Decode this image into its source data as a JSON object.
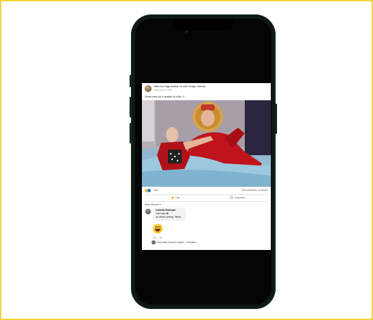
{
  "post": {
    "author": "Hahi-kim Ngrobiaban is with Sergiu Zamas",
    "date": "September 25, 2019 · ",
    "caption": "Zehaz zlew zàl în spatale lui Kõku ?!",
    "reaction_count": "545",
    "comments_shares": "128 comments  11 shares",
    "like_label": "Like",
    "comment_label": "Comment",
    "relevant_label": "Most relevant ▾"
  },
  "comment": {
    "author": "Ludmila Budoyan",
    "line1": "Cam aşa 😂",
    "line2": "ce vânde azamg. Yetiza",
    "meta": "11y · · 1K",
    "reply_text": "Ghrunisia Zandes replied · 4 Replies"
  },
  "colors": {
    "frame_border": "#f2d43a",
    "phone_body": "#0f1a12",
    "like_blue": "#1877f2",
    "haha_yellow": "#f7b928"
  },
  "icons": [
    "like-icon",
    "comment-icon",
    "haha-reaction-icon",
    "like-reaction-icon"
  ]
}
